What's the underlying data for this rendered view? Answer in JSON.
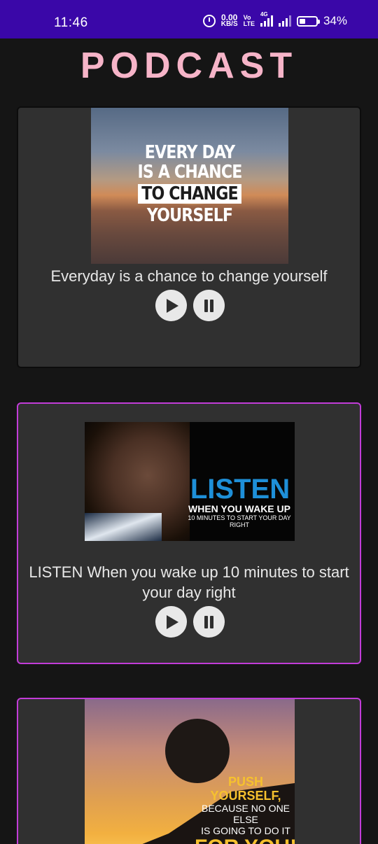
{
  "status_bar": {
    "time": "11:46",
    "net_speed_value": "0.00",
    "net_speed_unit": "KB/S",
    "volte_top": "Vo",
    "volte_bottom": "LTE",
    "network": "4G",
    "battery": "34%"
  },
  "page": {
    "title": "PODCAST"
  },
  "podcasts": [
    {
      "title": "Everyday is a chance to change yourself",
      "image_text": [
        "EVERY DAY",
        "IS A CHANCE",
        "TO CHANGE",
        "YOURSELF"
      ],
      "play_icon": "play-icon",
      "pause_icon": "pause-icon"
    },
    {
      "title": "LISTEN When you wake up 10 minutes to start your day right",
      "image_text": {
        "headline": "LISTEN",
        "line2": "WHEN YOU WAKE UP",
        "line3": "10 MINUTES TO START YOUR DAY RIGHT"
      },
      "play_icon": "play-icon",
      "pause_icon": "pause-icon"
    },
    {
      "image_text": {
        "line1": "PUSH YOURSELF,",
        "line2": "BECAUSE NO ONE ELSE",
        "line3": "IS GOING TO DO IT",
        "line4": "FOR YOU!"
      }
    }
  ],
  "colors": {
    "status_bar": "#3a07a8",
    "title": "#f6b4c8",
    "card_bg": "#303030",
    "active_border": "#c23cd8",
    "background": "#151515"
  }
}
